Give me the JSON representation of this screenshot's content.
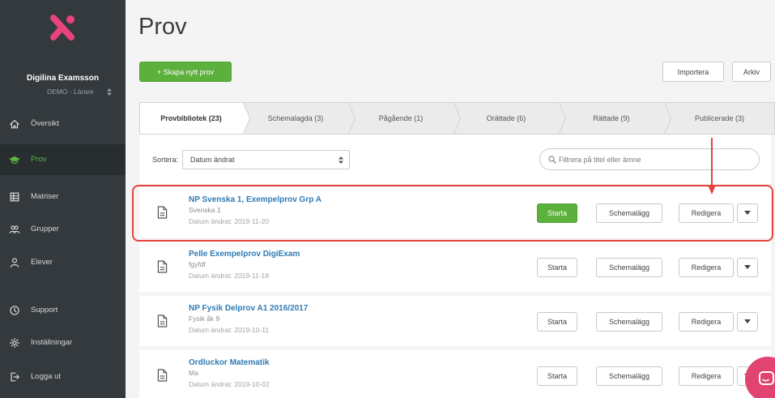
{
  "user": {
    "name": "Digilina Examsson",
    "role": "DEMO - Lärare",
    "role_switch_icon": "updown-icon"
  },
  "sidebar": {
    "items": [
      {
        "label": "Översikt",
        "icon": "home-icon"
      },
      {
        "label": "Prov",
        "icon": "exam-icon",
        "active": true
      },
      {
        "label": "Matriser",
        "icon": "matrix-icon"
      },
      {
        "label": "Grupper",
        "icon": "groups-icon"
      },
      {
        "label": "Elever",
        "icon": "students-icon"
      },
      {
        "label": "Support",
        "icon": "support-icon"
      },
      {
        "label": "Inställningar",
        "icon": "settings-icon"
      },
      {
        "label": "Logga ut",
        "icon": "logout-icon"
      }
    ]
  },
  "page": {
    "title": "Prov"
  },
  "toolbar": {
    "create_label": "+ Skapa nytt prov",
    "import_label": "Importera",
    "archive_label": "Arkiv"
  },
  "tabs": [
    {
      "label": "Provbibliotek (23)",
      "active": true
    },
    {
      "label": "Schemalagda (3)"
    },
    {
      "label": "Pågående (1)"
    },
    {
      "label": "Orättade (6)"
    },
    {
      "label": "Rättade (9)"
    },
    {
      "label": "Publicerade (3)"
    }
  ],
  "filters": {
    "sort_label": "Sortera:",
    "sort_value": "Datum ändrat",
    "search_placeholder": "Filtrera på titel eller ämne",
    "search_icon": "search-icon"
  },
  "exams": [
    {
      "title": "NP Svenska 1, Exempelprov Grp A",
      "subject": "Svenska 1",
      "modified": "Datum ändrat: 2019-11-20",
      "start_highlighted": true
    },
    {
      "title": "Pelle Exempelprov DigiExam",
      "subject": "fgyfdf",
      "modified": "Datum ändrat: 2019-11-18"
    },
    {
      "title": "NP Fysik Delprov A1 2016/2017",
      "subject": "Fysik åk 9",
      "modified": "Datum ändrat: 2019-10-11"
    },
    {
      "title": "Ordluckor Matematik",
      "subject": "Ma",
      "modified": "Datum ändrat: 2019-10-02"
    }
  ],
  "row_actions": {
    "start": "Starta",
    "schedule": "Schemalägg",
    "edit": "Redigera",
    "more_icon": "chevron-down-icon",
    "row_icon": "document-icon"
  },
  "annotation": {
    "highlighted_row": 0
  },
  "chat": {
    "icon": "chat-icon"
  },
  "colors": {
    "sidebar": "#33393d",
    "accent_green": "#5cb03c",
    "link_blue": "#2f7bb5",
    "annotation_red": "#e4443b",
    "chat_pink": "#e24471",
    "background": "#f4f4f4"
  }
}
